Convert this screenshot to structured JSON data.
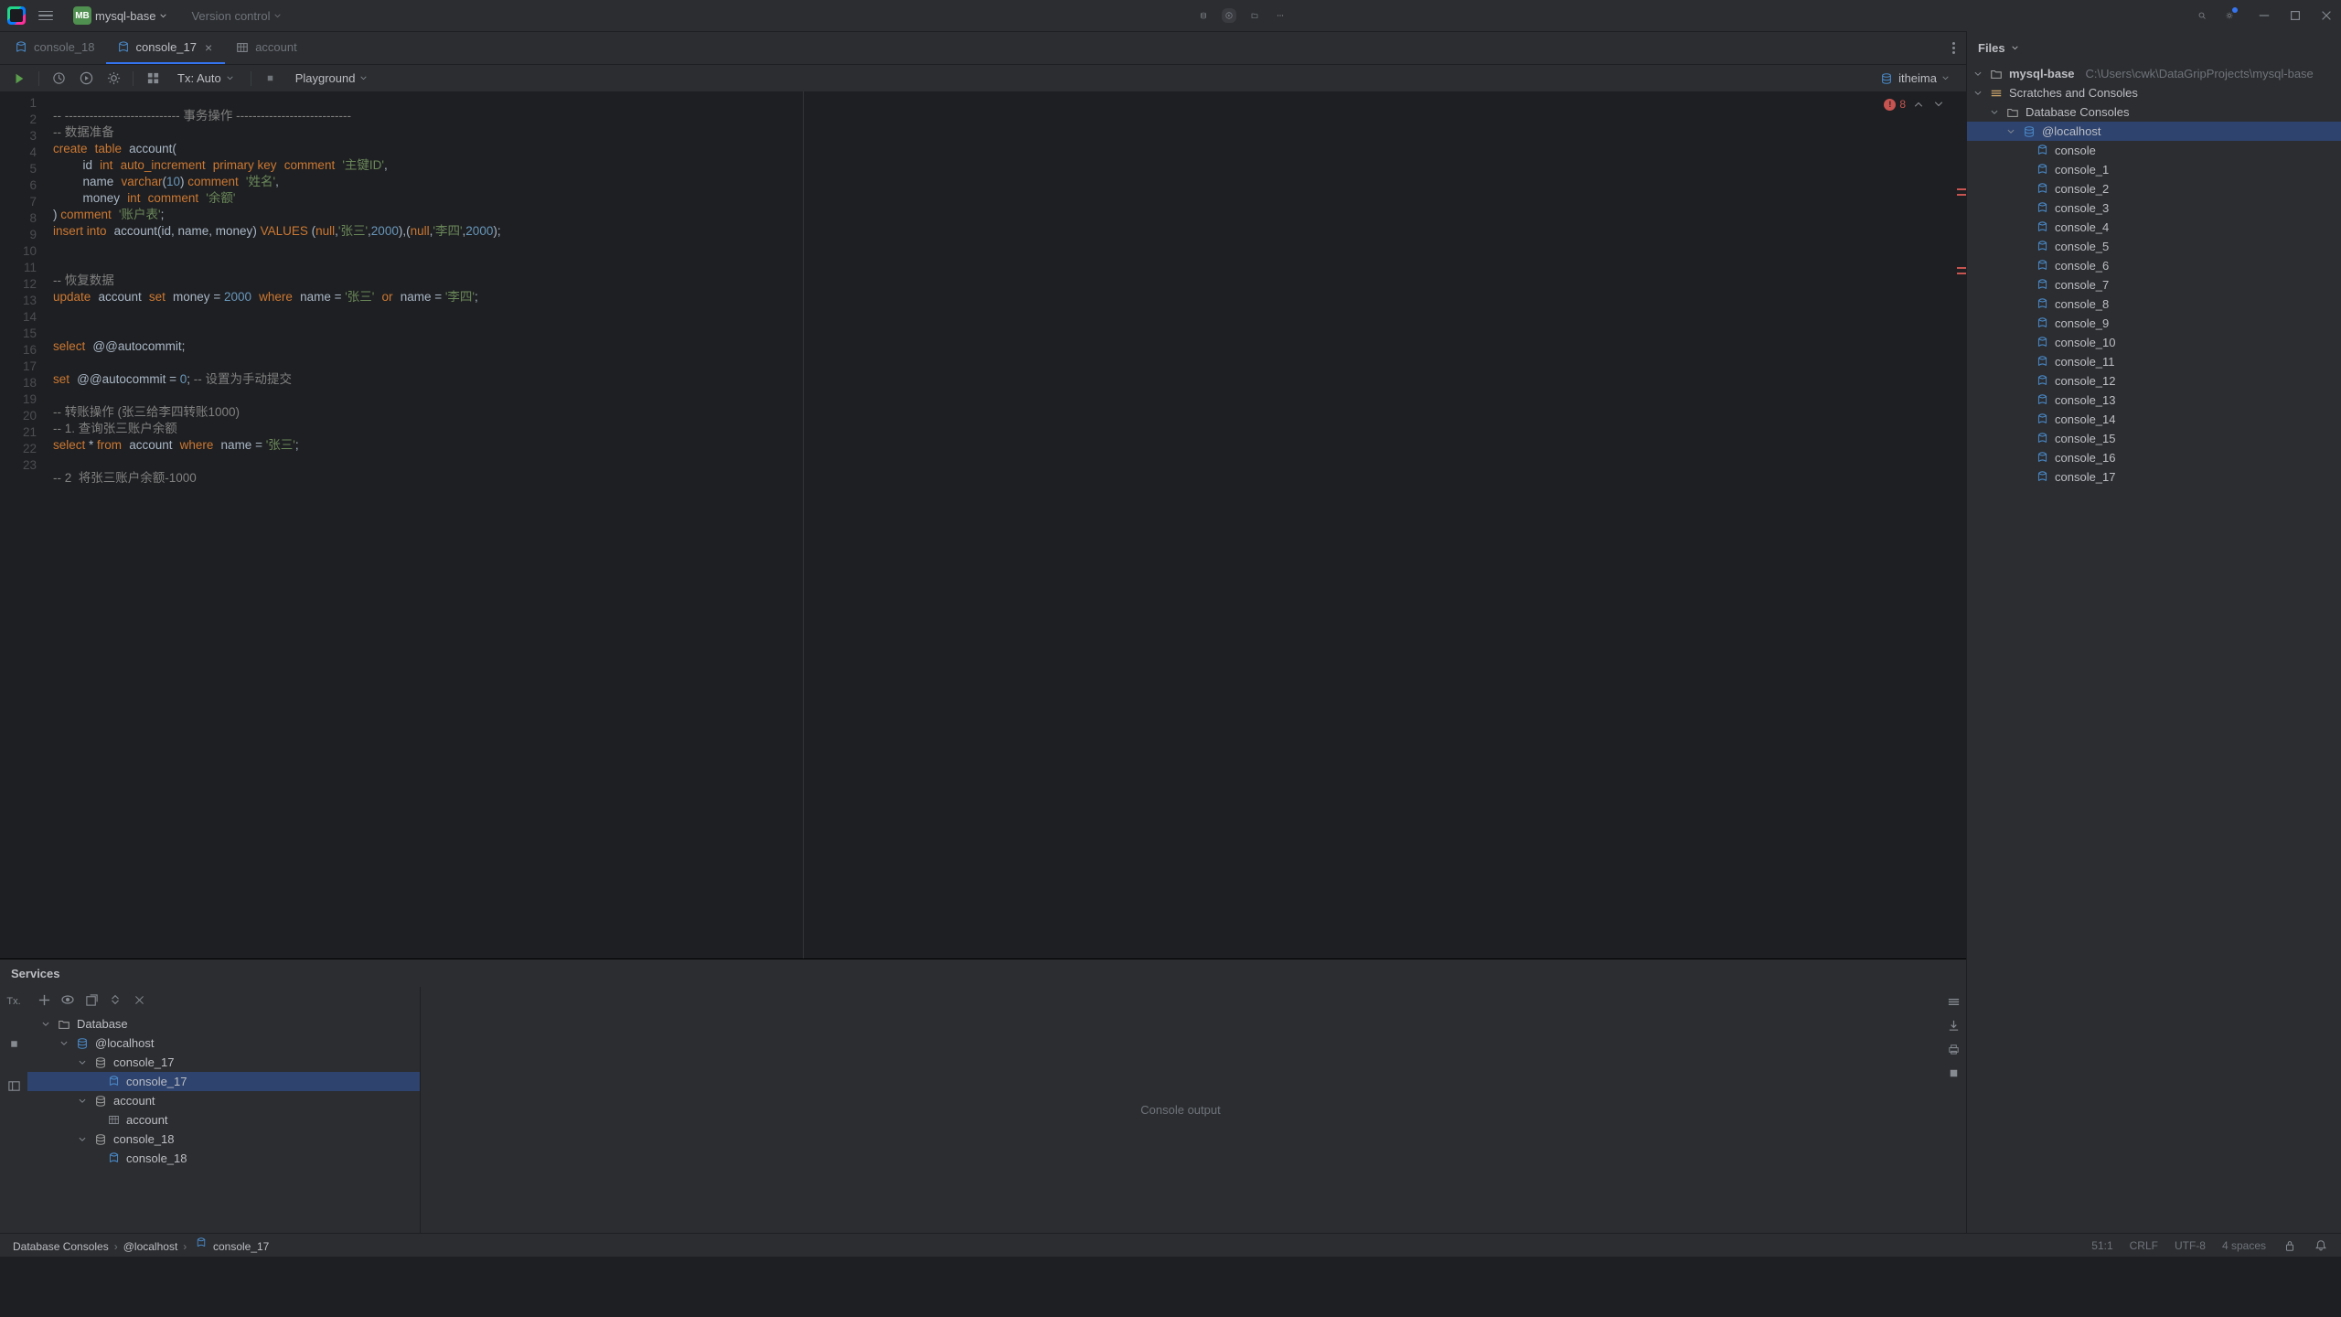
{
  "titlebar": {
    "project_badge": "MB",
    "project_name": "mysql-base",
    "version_control": "Version control"
  },
  "tabs": [
    {
      "name": "console_18",
      "type": "sql",
      "active": false,
      "close": false
    },
    {
      "name": "console_17",
      "type": "sql",
      "active": true,
      "close": true
    },
    {
      "name": "account",
      "type": "table",
      "active": false,
      "close": false
    }
  ],
  "toolbar": {
    "tx_label": "Tx: Auto",
    "mode_label": "Playground",
    "datasource": "itheima"
  },
  "editor": {
    "errors": "8",
    "gutter": [
      "1",
      "2",
      "3",
      "4",
      "5",
      "6",
      "7",
      "8",
      "9",
      "10",
      "11",
      "12",
      "13",
      "14",
      "15",
      "16",
      "17",
      "18",
      "19",
      "20",
      "21",
      "22",
      "23"
    ]
  },
  "code_plain": {
    "l1a": "-- ---------------------------- ",
    "l1b": "事务操作",
    "l1c": " ----------------------------",
    "l2": "-- 数据准备",
    "l3a": "create",
    "l3b": "table",
    "l3c": "account(",
    "l4a": "id",
    "l4b": "int",
    "l4c": "auto_increment",
    "l4d": "primary key",
    "l4e": "comment",
    "l4f": "'主键ID'",
    "l4g": ",",
    "l5a": "name",
    "l5b": "varchar",
    "l5c": "(",
    "l5d": "10",
    "l5e": ") ",
    "l5f": "comment",
    "l5g": "'姓名'",
    "l5h": ",",
    "l6a": "money",
    "l6b": "int",
    "l6c": "comment",
    "l6d": "'余额'",
    "l7a": ") ",
    "l7b": "comment",
    "l7c": "'账户表'",
    "l7d": ";",
    "l8a": "insert into",
    "l8b": "account(",
    "l8c": "id",
    "l8d": ", ",
    "l8e": "name",
    "l8f": ", ",
    "l8g": "money",
    "l8h": ") ",
    "l8i": "VALUES",
    "l8j": " (",
    "l8k": "null",
    "l8l": ",",
    "l8m": "'张三'",
    "l8n": ",",
    "l8o": "2000",
    "l8p": "),(",
    "l8q": "null",
    "l8r": ",",
    "l8s": "'李四'",
    "l8t": ",",
    "l8u": "2000",
    "l8v": ");",
    "l11": "-- 恢复数据",
    "l12a": "update",
    "l12b": "account",
    "l12c": "set",
    "l12d": "money",
    "l12e": " = ",
    "l12f": "2000",
    "l12g": "where",
    "l12h": "name",
    "l12i": " = ",
    "l12j": "'张三'",
    "l12k": "or",
    "l12l": "name",
    "l12m": " = ",
    "l12n": "'李四'",
    "l12o": ";",
    "l15a": "select",
    "l15b": "@@autocommit",
    "l15c": ";",
    "l17a": "set",
    "l17b": "@@autocommit",
    "l17c": " = ",
    "l17d": "0",
    "l17e": "; ",
    "l17f": "-- 设置为手动提交",
    "l19": "-- 转账操作 (张三给李四转账1000)",
    "l20": "-- 1. 查询张三账户余额",
    "l21a": "select",
    "l21b": " * ",
    "l21c": "from",
    "l21d": "account",
    "l21e": "where",
    "l21f": "name",
    "l21g": " = ",
    "l21h": "'张三'",
    "l21i": ";",
    "l23": "-- 2  将张三账户余额-1000"
  },
  "side": {
    "title": "Files",
    "project": "mysql-base",
    "project_path": "C:\\Users\\cwk\\DataGripProjects\\mysql-base",
    "scratches": "Scratches and Consoles",
    "dbc": "Database Consoles",
    "local": "@localhost",
    "console": "console",
    "consoles": [
      "console_1",
      "console_2",
      "console_3",
      "console_4",
      "console_5",
      "console_6",
      "console_7",
      "console_8",
      "console_9",
      "console_10",
      "console_11",
      "console_12",
      "console_13",
      "console_14",
      "console_15",
      "console_16",
      "console_17"
    ]
  },
  "services": {
    "title": "Services",
    "root": "Database",
    "host": "@localhost",
    "c17": "console_17",
    "c17_child": "console_17",
    "acct": "account",
    "acct_child": "account",
    "c18": "console_18",
    "c18_child": "console_18",
    "out": "Console output"
  },
  "breadcrumbs": {
    "a": "Database Consoles",
    "b": "@localhost",
    "c": "console_17"
  },
  "status": {
    "pos": "51:1",
    "eol": "CRLF",
    "enc": "UTF-8",
    "indent": "4 spaces"
  }
}
